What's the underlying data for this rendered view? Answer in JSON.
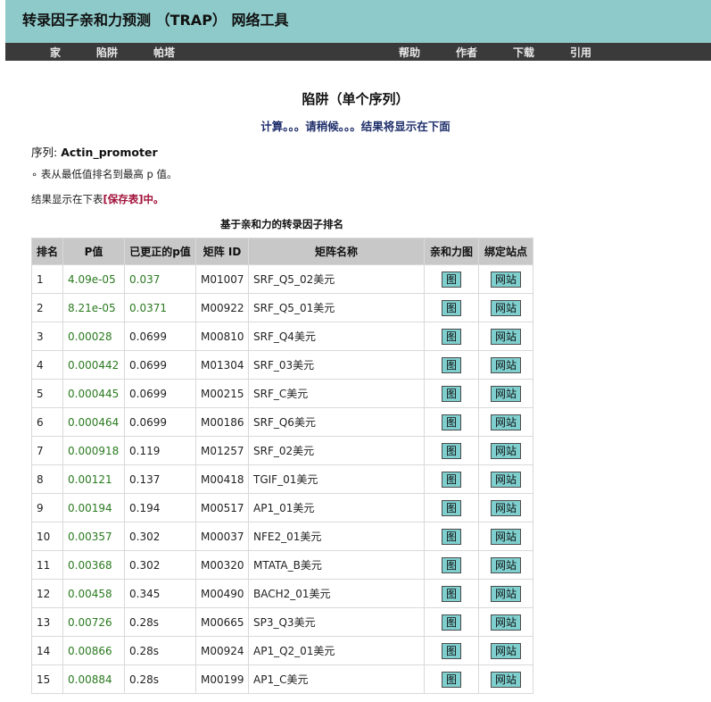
{
  "header": {
    "title": "转录因子亲和力预测 （TRAP） 网络工具"
  },
  "nav": {
    "home": "家",
    "trap": "陷阱",
    "pata": "帕塔",
    "help": "帮助",
    "author": "作者",
    "download": "下载",
    "cite": "引用"
  },
  "main": {
    "heading": "陷阱（单个序列）",
    "status": "计算。。。请稍候。。。结果将显示在下面",
    "sequence_label": "序列:",
    "sequence_name": "Actin_promoter",
    "sort_note": "表从最低值排名到最高 p 值。",
    "result_prefix": "结果显示在下表",
    "save_link": "[保存表]",
    "result_suffix": "中。",
    "table_caption": "基于亲和力的转录因子排名"
  },
  "table": {
    "headers": [
      "排名",
      "P值",
      "已更正的p值",
      "矩阵 ID",
      "矩阵名称",
      "亲和力图",
      "绑定站点"
    ],
    "plot_button": "图",
    "site_button": "网站",
    "rows": [
      {
        "rank": "1",
        "p": "4.09e-05",
        "corr": "0.037",
        "id": "M01007",
        "name": "SRF_Q5_02美元"
      },
      {
        "rank": "2",
        "p": "8.21e-05",
        "corr": "0.0371",
        "id": "M00922",
        "name": "SRF_Q5_01美元"
      },
      {
        "rank": "3",
        "p": "0.00028",
        "corr": "0.0699",
        "id": "M00810",
        "name": "SRF_Q4美元"
      },
      {
        "rank": "4",
        "p": "0.000442",
        "corr": "0.0699",
        "id": "M01304",
        "name": "SRF_03美元"
      },
      {
        "rank": "5",
        "p": "0.000445",
        "corr": "0.0699",
        "id": "M00215",
        "name": "SRF_C美元"
      },
      {
        "rank": "6",
        "p": "0.000464",
        "corr": "0.0699",
        "id": "M00186",
        "name": "SRF_Q6美元"
      },
      {
        "rank": "7",
        "p": "0.000918",
        "corr": "0.119",
        "id": "M01257",
        "name": "SRF_02美元"
      },
      {
        "rank": "8",
        "p": "0.00121",
        "corr": "0.137",
        "id": "M00418",
        "name": "TGIF_01美元"
      },
      {
        "rank": "9",
        "p": "0.00194",
        "corr": "0.194",
        "id": "M00517",
        "name": "AP1_01美元"
      },
      {
        "rank": "10",
        "p": "0.00357",
        "corr": "0.302",
        "id": "M00037",
        "name": "NFE2_01美元"
      },
      {
        "rank": "11",
        "p": "0.00368",
        "corr": "0.302",
        "id": "M00320",
        "name": "MTATA_B美元"
      },
      {
        "rank": "12",
        "p": "0.00458",
        "corr": "0.345",
        "id": "M00490",
        "name": "BACH2_01美元"
      },
      {
        "rank": "13",
        "p": "0.00726",
        "corr": "0.28s",
        "id": "M00665",
        "name": "SP3_Q3美元"
      },
      {
        "rank": "14",
        "p": "0.00866",
        "corr": "0.28s",
        "id": "M00924",
        "name": "AP1_Q2_01美元"
      },
      {
        "rank": "15",
        "p": "0.00884",
        "corr": "0.28s",
        "id": "M00199",
        "name": "AP1_C美元"
      }
    ]
  }
}
